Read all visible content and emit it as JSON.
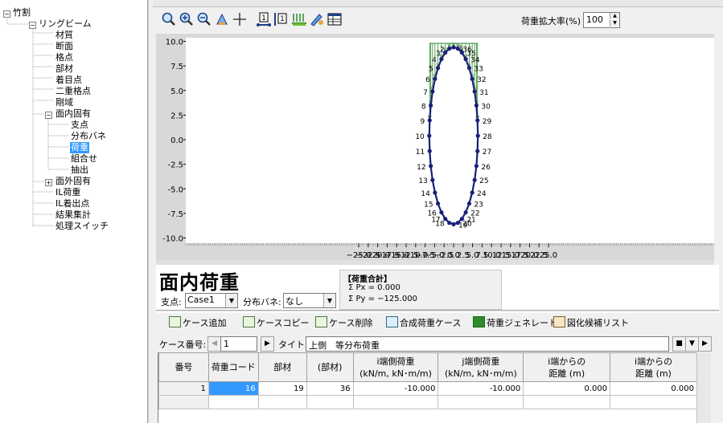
{
  "tree": {
    "root": "竹割",
    "ring_beam": "リングビーム",
    "items": [
      "材質",
      "断面",
      "格点",
      "部材",
      "着目点",
      "二重格点",
      "剛域"
    ],
    "in_plane": "面内固有",
    "in_plane_items": [
      "支点",
      "分布バネ",
      "荷重",
      "組合せ",
      "抽出"
    ],
    "out_plane": "面外固有",
    "bottom_items": [
      "IL荷重",
      "IL着出点",
      "結果集計",
      "処理スイッチ"
    ],
    "box_minus": "−",
    "box_plus": "+"
  },
  "toolbar": {
    "zoom_label": "荷重拡大率(%)",
    "zoom_value": "100",
    "spin_up": "▲",
    "spin_down": "▼",
    "icons": [
      "zoom-fit-icon",
      "zoom-in-icon",
      "zoom-out-icon",
      "pan-icon",
      "cursor-cross-icon",
      "node-number-icon",
      "member-number-icon",
      "load-display-icon",
      "edit-load-icon",
      "table-view-icon"
    ],
    "node_num_glyph": "1",
    "member_num_glyph": "1"
  },
  "plot": {
    "y_ticks": [
      "10.0",
      "7.5",
      "5.0",
      "2.5",
      "0.0",
      "-2.5",
      "-5.0",
      "-7.5",
      "-10.0"
    ],
    "x_ticks": [
      "-25.0",
      "-22.5",
      "-20.0",
      "-17.5",
      "-15.0",
      "-12.5",
      "-10.0",
      "-7.5",
      "-5.0",
      "-2.5",
      "0.0",
      "2.5",
      "5.0",
      "7.5",
      "10.0",
      "12.5",
      "15.0",
      "17.5",
      "20.0",
      "22.5",
      "25.0"
    ],
    "x_tick_labels": [
      "−25.0",
      "−22.5",
      "−20.0",
      "−17.5",
      "−15.0",
      "−12.5",
      "−10.0",
      "−7.5",
      "−5.0",
      "−2.5",
      "0.0",
      "2.5",
      "5.0",
      "7.5",
      "10.0",
      "12.5",
      "15.0",
      "17.5",
      "20.0",
      "22.5",
      "25.0"
    ],
    "node_count": 36,
    "colors": {
      "frame": "#1a1f7a",
      "load": "#2e8b2e",
      "background": "#ffffff",
      "axis_bg": "#d8d8d8"
    }
  },
  "info": {
    "title": "面内荷重",
    "support_label": "支点:",
    "support_value": "Case1",
    "spring_label": "分布バネ:",
    "spring_value": "なし",
    "dropdown_glyph": "▼",
    "sum_title": "【荷重合計】",
    "sum_px": "Σ Px = 0.000",
    "sum_py": "Σ Py = −125.000"
  },
  "actions": [
    "ケース追加",
    "ケースコピー",
    "ケース削除",
    "合成荷重ケース",
    "荷重ジェネレート",
    "図化候補リスト"
  ],
  "case": {
    "label": "ケース番号:",
    "value": "1",
    "prev": "◀",
    "next": "▶",
    "title_label": "タイトル:",
    "title_value": "上側　等分布荷重",
    "nav_stop": "■",
    "nav_down": "▼",
    "nav_right": "▶"
  },
  "grid": {
    "headers": [
      "番号",
      "荷重コード",
      "部材",
      "(部材)",
      "i端側荷重\n(kN/m, kN･m/m)",
      "j端側荷重\n(kN/m, kN･m/m)",
      "i端からの\n距離 (m)",
      "i端からの\n距離 (m)"
    ],
    "rows": [
      [
        "1",
        "16",
        "19",
        "36",
        "-10.000",
        "-10.000",
        "0.000",
        "0.000"
      ]
    ]
  }
}
